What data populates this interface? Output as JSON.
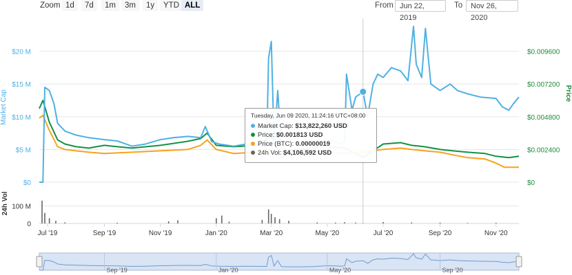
{
  "toolbar": {
    "zoom_label": "Zoom",
    "buttons": [
      "1d",
      "7d",
      "1m",
      "3m",
      "1y",
      "YTD",
      "ALL"
    ],
    "active": "ALL",
    "from_label": "From",
    "from_value": "Jun 22, 2019",
    "to_label": "To",
    "to_value": "Nov 26, 2020"
  },
  "colors": {
    "market_cap": "#4fb0e3",
    "price": "#119146",
    "price_btc": "#f7a21b",
    "volume": "#666666",
    "right_axis": "#1e8a3d",
    "navigator_fill": "#c9d8ef"
  },
  "tooltip": {
    "date": "Tuesday, Jun 09 2020, 11:24:16 UTC+08:00",
    "rows": [
      {
        "label": "Market Cap:",
        "value": "$13,822,260 USD"
      },
      {
        "label": "Price:",
        "value": "$0.001813 USD"
      },
      {
        "label": "Price (BTC):",
        "value": "0.00000019"
      },
      {
        "label": "24h Vol:",
        "value": "$4,106,592 USD"
      }
    ]
  },
  "chart_data": {
    "type": "line",
    "x_start": "2019-06-22",
    "x_end": "2020-11-26",
    "left_axis": {
      "label": "Market Cap",
      "ticks": [
        "$0",
        "$5 M",
        "$10 M",
        "$15 M",
        "$20 M"
      ],
      "ylim": [
        0,
        25000000
      ]
    },
    "right_axis": {
      "label": "Price",
      "ticks": [
        "$0",
        "$0.002400",
        "$0.004800",
        "$0.007200",
        "$0.009600"
      ],
      "ylim": [
        0,
        0.012
      ]
    },
    "volume_axis": {
      "label": "24h Vol",
      "ticks": [
        "0",
        "100 M"
      ],
      "ylim": [
        0,
        200000000
      ]
    },
    "x_ticks": [
      "Jul '19",
      "Sep '19",
      "Nov '19",
      "Jan '20",
      "Mar '20",
      "May '20",
      "Jul '20",
      "Sep '20",
      "Nov '20"
    ],
    "navigator_ticks": [
      "Sep '19",
      "Jan '20",
      "May '20",
      "Sep '20"
    ],
    "series": [
      {
        "name": "Market Cap",
        "x": [
          "2019-06-22",
          "2019-06-26",
          "2019-06-28",
          "2019-07-03",
          "2019-07-08",
          "2019-07-12",
          "2019-07-20",
          "2019-08-01",
          "2019-08-15",
          "2019-09-01",
          "2019-09-15",
          "2019-10-01",
          "2019-10-15",
          "2019-11-01",
          "2019-11-15",
          "2019-12-01",
          "2019-12-15",
          "2019-12-20",
          "2019-12-27",
          "2020-01-05",
          "2020-01-20",
          "2020-02-01",
          "2020-02-15",
          "2020-02-25",
          "2020-02-27",
          "2020-03-01",
          "2020-03-04",
          "2020-03-08",
          "2020-03-12",
          "2020-03-17",
          "2020-03-25",
          "2020-04-01",
          "2020-04-15",
          "2020-05-01",
          "2020-05-10",
          "2020-05-15",
          "2020-05-20",
          "2020-05-22",
          "2020-05-28",
          "2020-06-01",
          "2020-06-09",
          "2020-06-14",
          "2020-06-20",
          "2020-06-25",
          "2020-07-01",
          "2020-07-10",
          "2020-07-20",
          "2020-07-28",
          "2020-08-03",
          "2020-08-06",
          "2020-08-12",
          "2020-08-16",
          "2020-08-22",
          "2020-09-01",
          "2020-09-12",
          "2020-09-20",
          "2020-10-01",
          "2020-10-15",
          "2020-11-01",
          "2020-11-08",
          "2020-11-15",
          "2020-11-20",
          "2020-11-26"
        ],
        "values": [
          0,
          0,
          14500000,
          14000000,
          12000000,
          9000000,
          7800000,
          7200000,
          6800000,
          6500000,
          6300000,
          5500000,
          5800000,
          6500000,
          6800000,
          7000000,
          6800000,
          8500000,
          6200000,
          5800000,
          5500000,
          5800000,
          5600000,
          5500000,
          19000000,
          21500000,
          6000000,
          14000000,
          5200000,
          5000000,
          4800000,
          4900000,
          5200000,
          6500000,
          6200000,
          5800000,
          6300000,
          16500000,
          11000000,
          13000000,
          13822260,
          10000000,
          15000000,
          16500000,
          16000000,
          17500000,
          17000000,
          15500000,
          23800000,
          18000000,
          16000000,
          23500000,
          15000000,
          14000000,
          15000000,
          14000000,
          13500000,
          13000000,
          12800000,
          11500000,
          11000000,
          12000000,
          13000000
        ]
      },
      {
        "name": "Price",
        "x": [
          "2019-06-22",
          "2019-06-26",
          "2019-07-03",
          "2019-07-12",
          "2019-07-20",
          "2019-08-01",
          "2019-08-15",
          "2019-09-01",
          "2019-09-15",
          "2019-10-01",
          "2019-11-01",
          "2019-12-01",
          "2019-12-15",
          "2019-12-22",
          "2020-01-01",
          "2020-01-20",
          "2020-02-15",
          "2020-03-01",
          "2020-03-12",
          "2020-03-25",
          "2020-04-15",
          "2020-05-01",
          "2020-05-20",
          "2020-06-09",
          "2020-06-20",
          "2020-07-01",
          "2020-07-20",
          "2020-08-01",
          "2020-08-15",
          "2020-09-01",
          "2020-09-15",
          "2020-10-01",
          "2020-10-20",
          "2020-11-01",
          "2020-11-15",
          "2020-11-26"
        ],
        "values": [
          0.0054,
          0.006,
          0.0044,
          0.0031,
          0.0028,
          0.0026,
          0.0025,
          0.0027,
          0.0026,
          0.0025,
          0.0027,
          0.003,
          0.0032,
          0.0036,
          0.0027,
          0.0026,
          0.0027,
          0.0034,
          0.0018,
          0.0024,
          0.0025,
          0.0026,
          0.0025,
          0.001813,
          0.0023,
          0.0028,
          0.0029,
          0.0027,
          0.0026,
          0.0024,
          0.0023,
          0.0022,
          0.0021,
          0.0019,
          0.0018,
          0.0019
        ]
      },
      {
        "name": "Price (BTC)",
        "x": [
          "2019-06-22",
          "2019-06-26",
          "2019-07-03",
          "2019-07-12",
          "2019-07-20",
          "2019-08-01",
          "2019-08-15",
          "2019-09-01",
          "2019-10-01",
          "2019-11-01",
          "2019-12-01",
          "2019-12-15",
          "2019-12-22",
          "2020-01-01",
          "2020-01-20",
          "2020-02-15",
          "2020-03-01",
          "2020-03-12",
          "2020-03-25",
          "2020-04-15",
          "2020-05-01",
          "2020-05-20",
          "2020-06-09",
          "2020-06-20",
          "2020-07-01",
          "2020-07-20",
          "2020-08-01",
          "2020-08-15",
          "2020-09-01",
          "2020-09-15",
          "2020-10-01",
          "2020-10-20",
          "2020-11-01",
          "2020-11-10",
          "2020-11-26"
        ],
        "values": [
          0.0047,
          0.0049,
          0.0038,
          0.0026,
          0.0024,
          0.0023,
          0.0022,
          0.0021,
          0.0022,
          0.0023,
          0.0024,
          0.0027,
          0.0031,
          0.0024,
          0.0021,
          0.0022,
          0.0024,
          0.0021,
          0.0022,
          0.0023,
          0.0022,
          0.0021,
          0.0022,
          0.0023,
          0.0024,
          0.0025,
          0.0024,
          0.0023,
          0.0022,
          0.002,
          0.0018,
          0.0017,
          0.0014,
          0.0011,
          0.0011
        ]
      },
      {
        "name": "24h Vol",
        "x": [
          "2019-06-25",
          "2019-06-28",
          "2019-07-03",
          "2019-07-10",
          "2019-07-20",
          "2019-09-15",
          "2019-11-10",
          "2019-11-20",
          "2020-01-01",
          "2020-01-07",
          "2020-01-15",
          "2020-02-20",
          "2020-02-27",
          "2020-03-01",
          "2020-03-05",
          "2020-03-10",
          "2020-03-20",
          "2020-04-20",
          "2020-05-10",
          "2020-05-20",
          "2020-06-01",
          "2020-06-09",
          "2020-07-01",
          "2020-08-01",
          "2020-09-01",
          "2020-10-01",
          "2020-11-01"
        ],
        "values": [
          130000000,
          60000000,
          30000000,
          15000000,
          6000000,
          4000000,
          12000000,
          18000000,
          30000000,
          45000000,
          10000000,
          20000000,
          80000000,
          55000000,
          35000000,
          25000000,
          15000000,
          6000000,
          5000000,
          7000000,
          5000000,
          4106592,
          8000000,
          6000000,
          5000000,
          3000000,
          4000000
        ]
      }
    ]
  }
}
